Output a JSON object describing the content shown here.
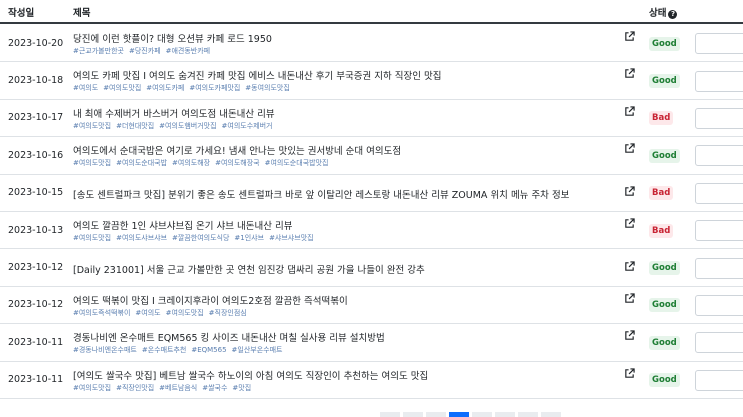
{
  "header": {
    "date": "작성일",
    "title": "제목",
    "status": "상태",
    "status_help_icon": "question-circle-icon"
  },
  "rows": [
    {
      "date": "2023-10-20",
      "title": "당진에 이런 핫플이? 대형 오션뷰 카페 로드 1950",
      "tags": [
        "#근교가볼만한곳",
        "#당진카페",
        "#애견동반카페"
      ],
      "status": "Good"
    },
    {
      "date": "2023-10-18",
      "title": "여의도 카페 맛집 I 여의도 숨겨진 카페 맛집 에비스 내돈내산 후기 부국증권 지하 직장인 맛집",
      "tags": [
        "#여의도",
        "#여의도맛집",
        "#여의도카페",
        "#여의도카페맛집",
        "#동여의도맛집"
      ],
      "status": "Good"
    },
    {
      "date": "2023-10-17",
      "title": "내 최애 수제버거 바스버거 여의도점 내돈내산 리뷰",
      "tags": [
        "#여의도맛집",
        "#더현대맛집",
        "#여의도햄버거맛집",
        "#여의도수제버거"
      ],
      "status": "Bad"
    },
    {
      "date": "2023-10-16",
      "title": "여의도에서 순대국밥은 여기로 가세요! 냄새 안나는 맛있는 권서방네 순대 여의도점",
      "tags": [
        "#여의도맛집",
        "#여의도순대국밥",
        "#여의도해장",
        "#여의도해장국",
        "#여의도순대국밥맛집"
      ],
      "status": "Good"
    },
    {
      "date": "2023-10-15",
      "title": "[송도 센트럴파크 맛집] 분위기 좋은 송도 센트럴파크 바로 앞 이탈리안 레스토랑 내돈내산 리뷰 ZOUMA 위치 메뉴 주차 정보",
      "tags": [],
      "status": "Bad"
    },
    {
      "date": "2023-10-13",
      "title": "여의도 깔끔한 1인 샤브샤브집 온기 샤브 내돈내산 리뷰",
      "tags": [
        "#여의도맛집",
        "#여의도샤브샤브",
        "#깔끔한여의도식당",
        "#1인샤브",
        "#샤브샤브맛집"
      ],
      "status": "Bad"
    },
    {
      "date": "2023-10-12",
      "title": "[Daily 231001] 서울 근교 가볼만한 곳 연천 임진강 댑싸리 공원 가을 나들이 완전 강추",
      "tags": [],
      "status": "Good"
    },
    {
      "date": "2023-10-12",
      "title": "여의도 떡볶이 맛집 I 크레이지후라이 여의도2호점 깔끔한 즉석떡볶이",
      "tags": [
        "#여의도즉석떡볶이",
        "#여의도",
        "#여의도맛집",
        "#직장인점심"
      ],
      "status": "Good"
    },
    {
      "date": "2023-10-11",
      "title": "경동나비엔 온수매트 EQM565 킹 사이즈 내돈내산 며칠 실사용 리뷰 설치방법",
      "tags": [
        "#경동나비엔온수매트",
        "#온수매트추천",
        "#EQM565",
        "#일산부온수매트"
      ],
      "status": "Good"
    },
    {
      "date": "2023-10-11",
      "title": "[여의도 쌀국수 맛집] 베트남 쌀국수 하노이의 아침 여의도 직장인이 추천하는 여의도 맛집",
      "tags": [
        "#여의도맛집",
        "#직장인맛집",
        "#베트남음식",
        "#쌀국수",
        "#맛집"
      ],
      "status": "Good"
    }
  ],
  "icons": {
    "external": "external-link-icon"
  },
  "colors": {
    "good_bg": "#e6f4ea",
    "good_text": "#1e7e34",
    "bad_bg": "#fde8ea",
    "bad_text": "#c82333",
    "tag_text": "#5b7fb0",
    "pager_active": "#0d6efd"
  }
}
